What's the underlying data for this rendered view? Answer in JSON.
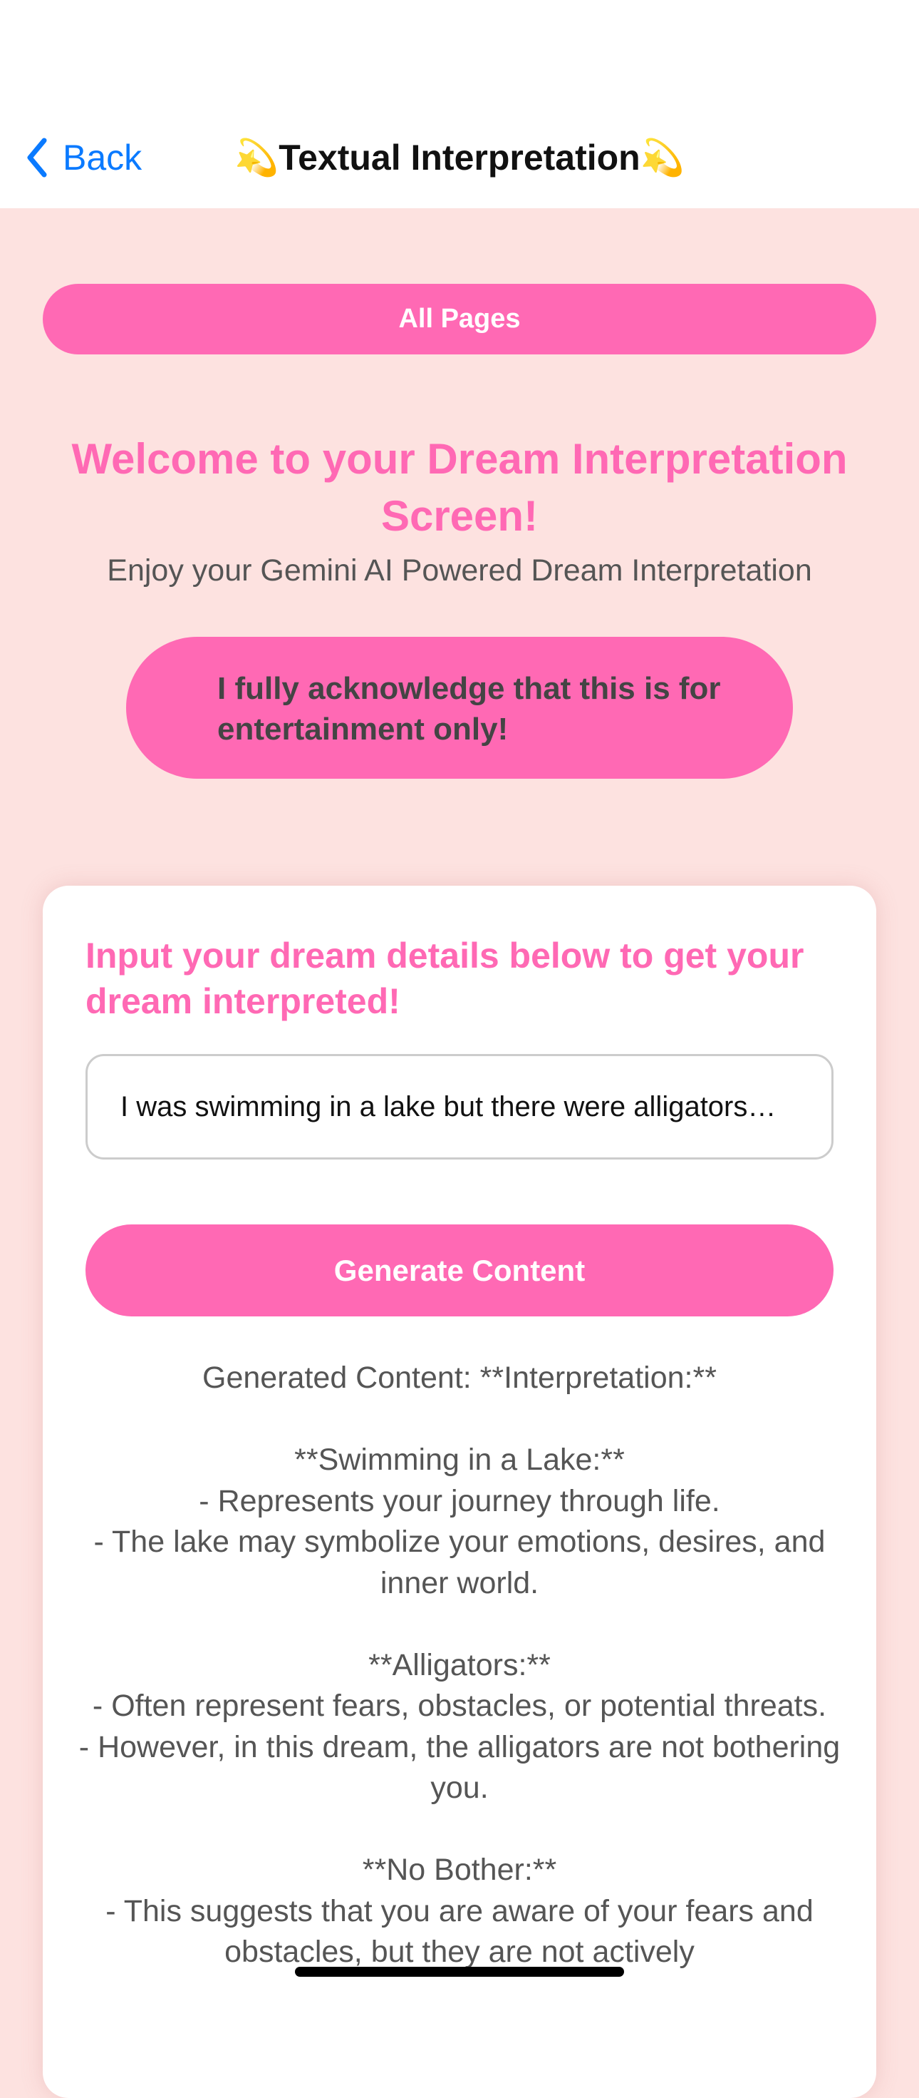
{
  "nav": {
    "back_label": "Back",
    "title": "💫Textual Interpretation💫"
  },
  "all_pages_label": "All Pages",
  "welcome": {
    "heading": "Welcome to your Dream Interpretation Screen!",
    "subtitle": "Enjoy your Gemini AI Powered Dream Interpretation"
  },
  "acknowledge_label": "I fully acknowledge that this is for entertainment only!",
  "card": {
    "heading": "Input your dream details below to get your dream interpreted!",
    "input_value": "I was swimming in a lake but there were alligators…",
    "generate_label": "Generate Content",
    "generated_content": "Generated Content: **Interpretation:**\n\n**Swimming in a Lake:**\n- Represents your journey through life.\n- The lake may symbolize your emotions, desires, and inner world.\n\n**Alligators:**\n- Often represent fears, obstacles, or potential threats.\n- However, in this dream, the alligators are not bothering you.\n\n**No Bother:**\n- This suggests that you are aware of your fears and obstacles, but they are not actively"
  }
}
